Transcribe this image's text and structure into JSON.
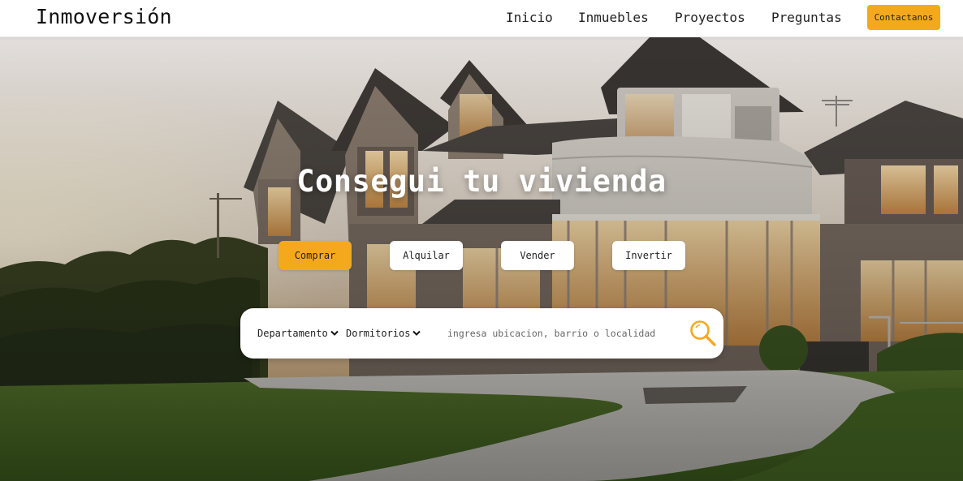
{
  "header": {
    "logo": "Inmoversión",
    "nav": [
      "Inicio",
      "Inmuebles",
      "Proyectos",
      "Preguntas"
    ],
    "contact_label": "Contactanos"
  },
  "hero": {
    "title": "Consegui tu vivienda",
    "operations": [
      "Comprar",
      "Alquilar",
      "Vender",
      "Invertir"
    ],
    "active_operation": "Comprar"
  },
  "search": {
    "type_value": "Departamento",
    "bedrooms_value": "Dormitorios",
    "placeholder": "ingresa ubicacion, barrio o localidad",
    "icon": "search-icon"
  },
  "colors": {
    "accent": "#f4a91d",
    "header_bg": "#ffffff",
    "text": "#222222"
  }
}
